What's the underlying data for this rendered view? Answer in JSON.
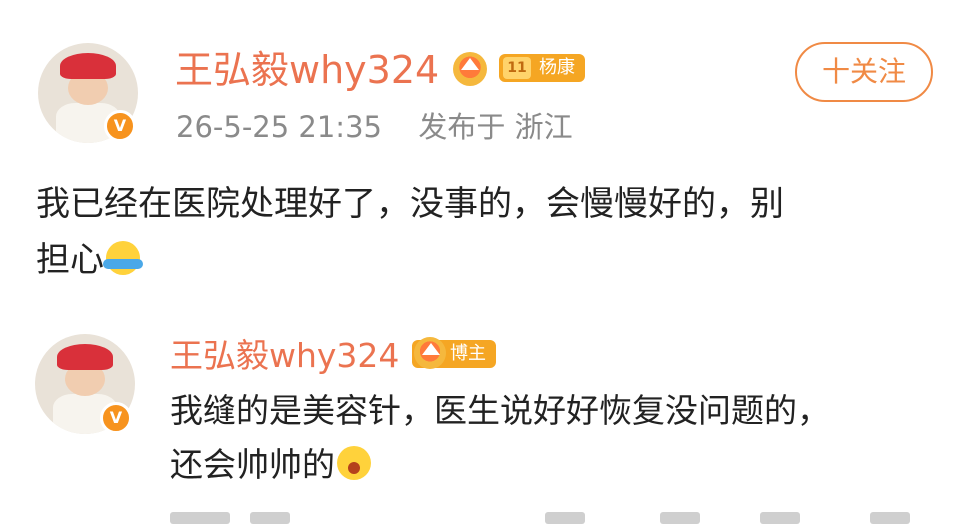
{
  "post": {
    "author": "王弘毅why324",
    "level_tag": {
      "level": "11",
      "label": "杨康"
    },
    "timestamp": "26-5-25 21:35",
    "published_from": "发布于 浙江",
    "follow_label": "十关注",
    "content_line1": "我已经在医院处理好了，没事的，会慢慢好的，别",
    "content_line2": "担心",
    "content_emoji": "hug-emoji"
  },
  "reply": {
    "author": "王弘毅why324",
    "role_tag": "博主",
    "content_line1": "我缝的是美容针，医生说好好恢复没问题的，",
    "content_line2": "还会帅帅的",
    "content_emoji": "shy-emoji"
  },
  "colors": {
    "name": "#eb7350",
    "follow": "#f08a45",
    "tag": "#f5a623",
    "verified": "#f7931e",
    "text": "#222222",
    "meta": "#8a8a8a"
  }
}
